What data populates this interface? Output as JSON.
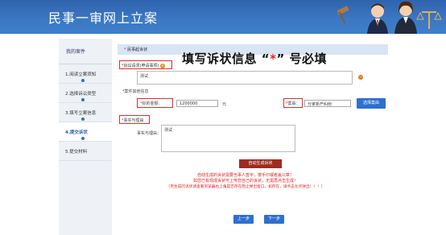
{
  "header": {
    "title": "民事一审网上立案"
  },
  "sidebar": {
    "heading": "我的案件",
    "items": [
      {
        "label": "1.阅读立案须知"
      },
      {
        "label": "2.选择诉讼类型"
      },
      {
        "label": "3.填写立案信息"
      },
      {
        "label": "4.提交诉状",
        "active": true
      },
      {
        "label": "5.提交材料"
      }
    ]
  },
  "form": {
    "section_title": "民事起诉状",
    "claims_label": "诉讼请求(申请事项)",
    "claims_value": "测试",
    "case_info_label": "案件其他信息",
    "amount_label": "标的金额：",
    "amount_value": "1200000",
    "amount_unit": "元",
    "cause_label": "案由：",
    "cause_value": "分家析产纠纷",
    "select_cause_button": "选择案由",
    "facts_label": "事实与理由",
    "facts_sub_label": "事实与理由：",
    "facts_value": "测试"
  },
  "annotation": {
    "part1": "填写诉状信息 “",
    "star": "*",
    "part2": "” 号必填"
  },
  "actions": {
    "generate_button": "自动生成诉状",
    "notice_lines": [
      "自动生成的诉状需要当事人签字，按手印或者盖公章！",
      "如您已有现成诉状可上传您自己的诉状，无需再点击生成！",
      "（另生成的诉状请查看浏览器右上角是否存在阻止弹出窗口，如存在，请点击允许弹出！！！）"
    ],
    "prev_button": "上一步",
    "next_button": "下一步"
  },
  "colors": {
    "header_blue": "#3a72be",
    "accent_red": "#e02020",
    "button_blue": "#2e6fd0"
  }
}
